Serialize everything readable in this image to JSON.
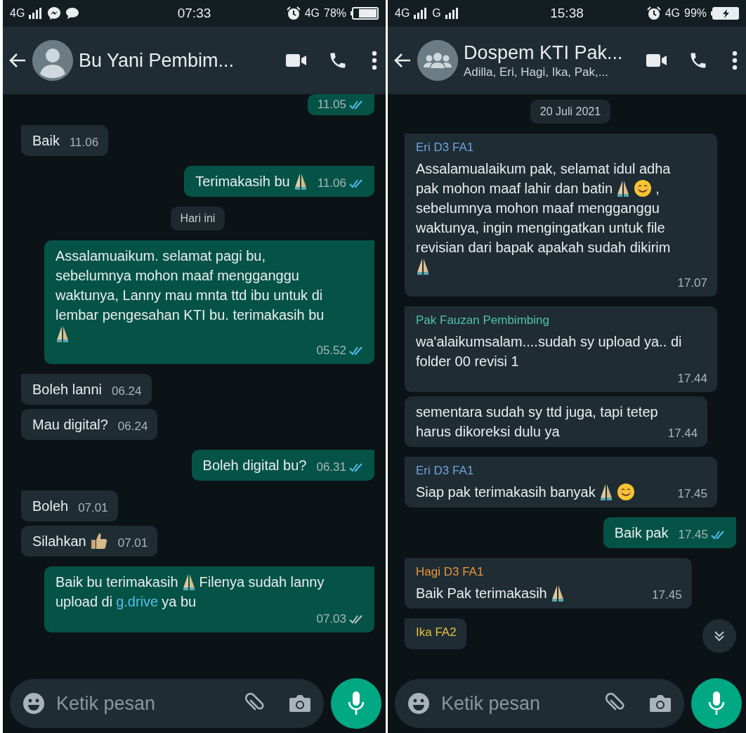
{
  "panels": [
    {
      "status_bar": {
        "left": [
          {
            "kind": "text",
            "text": "4G"
          },
          {
            "kind": "signal"
          },
          {
            "kind": "messenger"
          },
          {
            "kind": "chat"
          }
        ],
        "time": "07:33",
        "right": [
          {
            "kind": "alarm"
          },
          {
            "kind": "network",
            "text": "4G"
          },
          {
            "kind": "text",
            "text": "78%"
          },
          {
            "kind": "battery"
          }
        ]
      },
      "header": {
        "avatar": {
          "kind": "person"
        },
        "title": "Bu Yani Pembim..."
      },
      "messages": [
        {
          "kind": "out",
          "time": "11.05",
          "read": true
        },
        {
          "kind": "in",
          "lines": [
            [
              {
                "kind": "text",
                "text": "Baik"
              }
            ]
          ],
          "time": "11.06"
        },
        {
          "kind": "out",
          "lines": [
            [
              {
                "kind": "text",
                "text": "Terimakasih bu"
              },
              {
                "kind": "pray"
              }
            ]
          ],
          "time": "11.06",
          "read": true
        },
        {
          "kind": "date",
          "text": "Hari ini"
        },
        {
          "kind": "out",
          "lines": [
            [
              {
                "kind": "text",
                "text": "Assalamuaikum. selamat pagi bu,"
              }
            ],
            [
              {
                "kind": "text",
                "text": "sebelumnya mohon maaf mengganggu"
              }
            ],
            [
              {
                "kind": "text",
                "text": "waktunya, Lanny mau mnta ttd ibu untuk di"
              }
            ],
            [
              {
                "kind": "text",
                "text": "lembar pengesahan KTI bu. terimakasih bu"
              }
            ],
            [
              {
                "kind": "pray"
              }
            ]
          ],
          "time": "05.52",
          "read": true
        },
        {
          "kind": "in",
          "lines": [
            [
              {
                "kind": "text",
                "text": "Boleh lanni"
              }
            ]
          ],
          "time": "06.24"
        },
        {
          "kind": "in",
          "cont": true,
          "lines": [
            [
              {
                "kind": "text",
                "text": "Mau digital?"
              }
            ]
          ],
          "time": "06.24"
        },
        {
          "kind": "out",
          "lines": [
            [
              {
                "kind": "text",
                "text": "Boleh digital bu?"
              }
            ]
          ],
          "time": "06.31",
          "read": true
        },
        {
          "kind": "in",
          "lines": [
            [
              {
                "kind": "text",
                "text": "Boleh"
              }
            ]
          ],
          "time": "07.01"
        },
        {
          "kind": "in",
          "cont": true,
          "lines": [
            [
              {
                "kind": "text",
                "text": "Silahkan"
              },
              {
                "kind": "thumbs"
              }
            ]
          ],
          "time": "07.01"
        },
        {
          "kind": "out",
          "lines": [
            [
              {
                "kind": "text",
                "text": "Baik bu terimakasih"
              },
              {
                "kind": "pray"
              },
              {
                "kind": "text",
                "text": "Filenya sudah lanny"
              }
            ],
            [
              {
                "kind": "text",
                "text": "upload di"
              },
              {
                "kind": "link",
                "text": "g.drive"
              },
              {
                "kind": "text",
                "text": "ya bu"
              }
            ]
          ],
          "time": "07.03",
          "read": false
        }
      ],
      "input": {
        "placeholder": "Ketik pesan"
      }
    },
    {
      "status_bar": {
        "left": [
          {
            "kind": "text",
            "text": "4G"
          },
          {
            "kind": "signal"
          },
          {
            "kind": "text",
            "text": "G"
          },
          {
            "kind": "signal"
          }
        ],
        "time": "15:38",
        "right": [
          {
            "kind": "alarm"
          },
          {
            "kind": "network",
            "text": "4G"
          },
          {
            "kind": "text",
            "text": "99%"
          },
          {
            "kind": "battery_charging"
          }
        ]
      },
      "header": {
        "avatar": {
          "kind": "group"
        },
        "title": "Dospem KTI Pak...",
        "subtitle": "Adilla, Eri, Hagi, Ika, Pak,..."
      },
      "messages": [
        {
          "kind": "date",
          "text": "20 Juli 2021"
        },
        {
          "kind": "in",
          "sender": "Eri D3 FA1",
          "color": "#6fa3e0",
          "lines": [
            [
              {
                "kind": "text",
                "text": "Assalamualaikum pak, selamat idul adha"
              }
            ],
            [
              {
                "kind": "text",
                "text": "pak mohon maaf lahir dan batin"
              },
              {
                "kind": "pray"
              },
              {
                "kind": "smile"
              },
              {
                "kind": "text",
                "text": ","
              }
            ],
            [
              {
                "kind": "text",
                "text": "sebelumnya mohon maaf mengganggu"
              }
            ],
            [
              {
                "kind": "text",
                "text": "waktunya, ingin mengingatkan untuk file"
              }
            ],
            [
              {
                "kind": "text",
                "text": "revisian dari bapak apakah sudah dikirim"
              }
            ],
            [
              {
                "kind": "pray"
              }
            ]
          ],
          "time": "17.07"
        },
        {
          "kind": "in",
          "sender": "Pak Fauzan Pembimbing",
          "color": "#4fc3ae",
          "lines": [
            [
              {
                "kind": "text",
                "text": "wa'alaikumsalam....sudah sy upload ya.. di"
              }
            ],
            [
              {
                "kind": "text",
                "text": "folder 00 revisi 1"
              }
            ]
          ],
          "time": "17.44"
        },
        {
          "kind": "in",
          "cont": true,
          "lines": [
            [
              {
                "kind": "text",
                "text": "sementara sudah sy ttd juga, tapi tetep"
              }
            ],
            [
              {
                "kind": "text",
                "text": "harus dikoreksi dulu ya"
              }
            ]
          ],
          "time": "17.44"
        },
        {
          "kind": "in",
          "sender": "Eri D3 FA1",
          "color": "#6fa3e0",
          "lines": [
            [
              {
                "kind": "text",
                "text": "Siap pak terimakasih banyak"
              },
              {
                "kind": "pray"
              },
              {
                "kind": "smile"
              }
            ]
          ],
          "time": "17.45"
        },
        {
          "kind": "out",
          "lines": [
            [
              {
                "kind": "text",
                "text": "Baik pak"
              }
            ]
          ],
          "time": "17.45",
          "read": true
        },
        {
          "kind": "in",
          "sender": "Hagi D3 FA1",
          "color": "#e8963a",
          "lines": [
            [
              {
                "kind": "text",
                "text": "Baik Pak terimakasih"
              },
              {
                "kind": "pray"
              }
            ]
          ],
          "time": "17.45"
        },
        {
          "kind": "in",
          "sender": "Ika FA2",
          "color": "#e2c23a"
        }
      ],
      "scroll_down": true,
      "input": {
        "placeholder": "Ketik pesan"
      }
    }
  ]
}
